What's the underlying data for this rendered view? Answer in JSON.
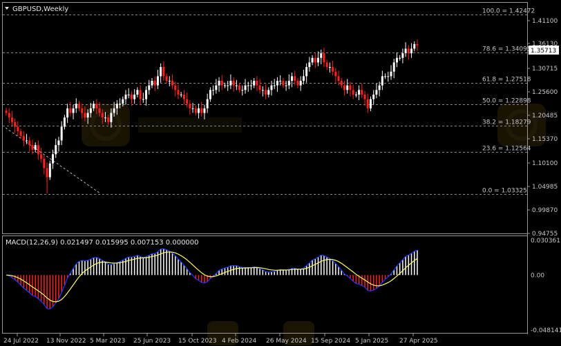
{
  "symbol_title": "GBPUSD,Weekly",
  "macd_title": "MACD(12,26,9) 0.021497 0.015995 0.007153 0.000000",
  "current_price": "1.35713",
  "colors": {
    "background": "#000000",
    "bull": "#ffffff",
    "bear": "#ff2020",
    "grid": "#8a8a8a",
    "axis_text": "#c8c8c8",
    "macd_line": "#1e3cff",
    "signal_line": "#ffff66",
    "hist_pos": "#ffffff",
    "hist_neg": "#ff2020",
    "watermark": "#3a2e0a"
  },
  "chart_data": [
    {
      "type": "candlestick",
      "title": "GBPUSD,Weekly",
      "ylim": [
        0.94755,
        1.45
      ],
      "y_ticks": [
        "1.41100",
        "1.36130",
        "1.30715",
        "1.25600",
        "1.20485",
        "1.15370",
        "1.10100",
        "1.04985",
        "0.99870",
        "0.94755"
      ],
      "x_labels": [
        "24 Jul 2022",
        "13 Nov 2022",
        "5 Mar 2023",
        "25 Jun 2023",
        "15 Oct 2023",
        "4 Feb 2024",
        "26 May 2024",
        "15 Sep 2024",
        "5 Jan 2025",
        "27 Apr 2025"
      ],
      "fibonacci_levels": [
        {
          "label": "100.0 = 1.42472",
          "value": 1.42472
        },
        {
          "label": "78.6 = 1.34095",
          "value": 1.34095
        },
        {
          "label": "61.8 = 1.27518",
          "value": 1.27518
        },
        {
          "label": "50.0 = 1.22898",
          "value": 1.22898
        },
        {
          "label": "38.2 = 1.18279",
          "value": 1.18279
        },
        {
          "label": "23.6 = 1.12564",
          "value": 1.12564
        },
        {
          "label": "0.0 = 1.03325",
          "value": 1.03325
        }
      ],
      "close_series": [
        1.21,
        1.2,
        1.19,
        1.18,
        1.17,
        1.16,
        1.15,
        1.15,
        1.14,
        1.13,
        1.14,
        1.12,
        1.11,
        1.09,
        1.07,
        1.1,
        1.12,
        1.14,
        1.15,
        1.18,
        1.2,
        1.22,
        1.21,
        1.22,
        1.23,
        1.22,
        1.21,
        1.2,
        1.21,
        1.22,
        1.23,
        1.22,
        1.21,
        1.2,
        1.2,
        1.19,
        1.21,
        1.22,
        1.23,
        1.23,
        1.24,
        1.25,
        1.25,
        1.24,
        1.25,
        1.26,
        1.24,
        1.24,
        1.26,
        1.27,
        1.28,
        1.27,
        1.29,
        1.31,
        1.29,
        1.28,
        1.28,
        1.27,
        1.26,
        1.25,
        1.25,
        1.24,
        1.23,
        1.22,
        1.22,
        1.21,
        1.22,
        1.21,
        1.22,
        1.24,
        1.26,
        1.26,
        1.27,
        1.28,
        1.27,
        1.27,
        1.27,
        1.28,
        1.27,
        1.27,
        1.26,
        1.26,
        1.27,
        1.27,
        1.27,
        1.28,
        1.27,
        1.26,
        1.26,
        1.25,
        1.26,
        1.27,
        1.27,
        1.28,
        1.28,
        1.27,
        1.27,
        1.28,
        1.29,
        1.28,
        1.27,
        1.28,
        1.29,
        1.31,
        1.32,
        1.33,
        1.32,
        1.33,
        1.34,
        1.32,
        1.31,
        1.31,
        1.3,
        1.29,
        1.28,
        1.27,
        1.26,
        1.27,
        1.26,
        1.25,
        1.25,
        1.26,
        1.25,
        1.24,
        1.22,
        1.24,
        1.25,
        1.26,
        1.27,
        1.29,
        1.29,
        1.29,
        1.3,
        1.32,
        1.33,
        1.33,
        1.34,
        1.35,
        1.34,
        1.35,
        1.36,
        1.357
      ]
    },
    {
      "type": "macd",
      "title": "MACD(12,26,9) 0.021497 0.015995 0.007153 0.000000",
      "ylim": [
        -0.048141,
        0.030361
      ],
      "y_ticks": [
        "0.030361",
        "0.00",
        "-0.048141"
      ],
      "series_values": {
        "macd": 0.021497,
        "signal": 0.015995,
        "histogram": 0.007153
      }
    }
  ]
}
